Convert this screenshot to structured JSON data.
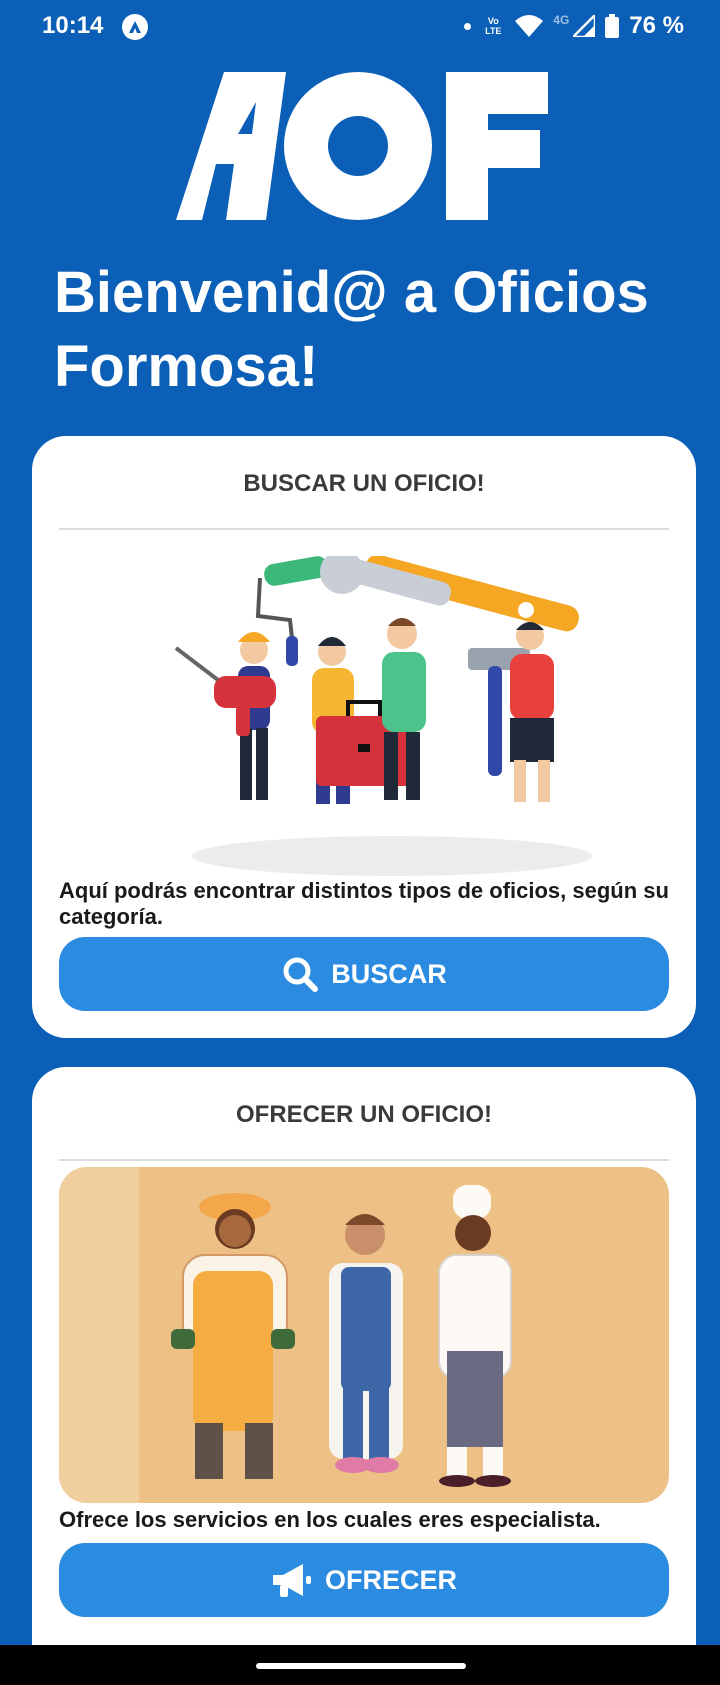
{
  "status_bar": {
    "time": "10:14",
    "network": "4G",
    "volte": "Vo LTE",
    "battery": "76 %"
  },
  "header": {
    "logo_text": "AOF",
    "title": "Bienvenid@ a Oficios Formosa!"
  },
  "search_card": {
    "title": "BUSCAR UN OFICIO!",
    "description": "Aquí podrás encontrar distintos tipos de oficios, según su categoría.",
    "button_label": "BUSCAR",
    "button_icon": "search-icon"
  },
  "offer_card": {
    "title": "OFRECER UN OFICIO!",
    "description": "Ofrece los servicios en los cuales eres especialista.",
    "button_label": "OFRECER",
    "button_icon": "megaphone-icon"
  },
  "colors": {
    "background": "#0b5fb7",
    "button": "#2b8be0",
    "card": "#ffffff"
  }
}
